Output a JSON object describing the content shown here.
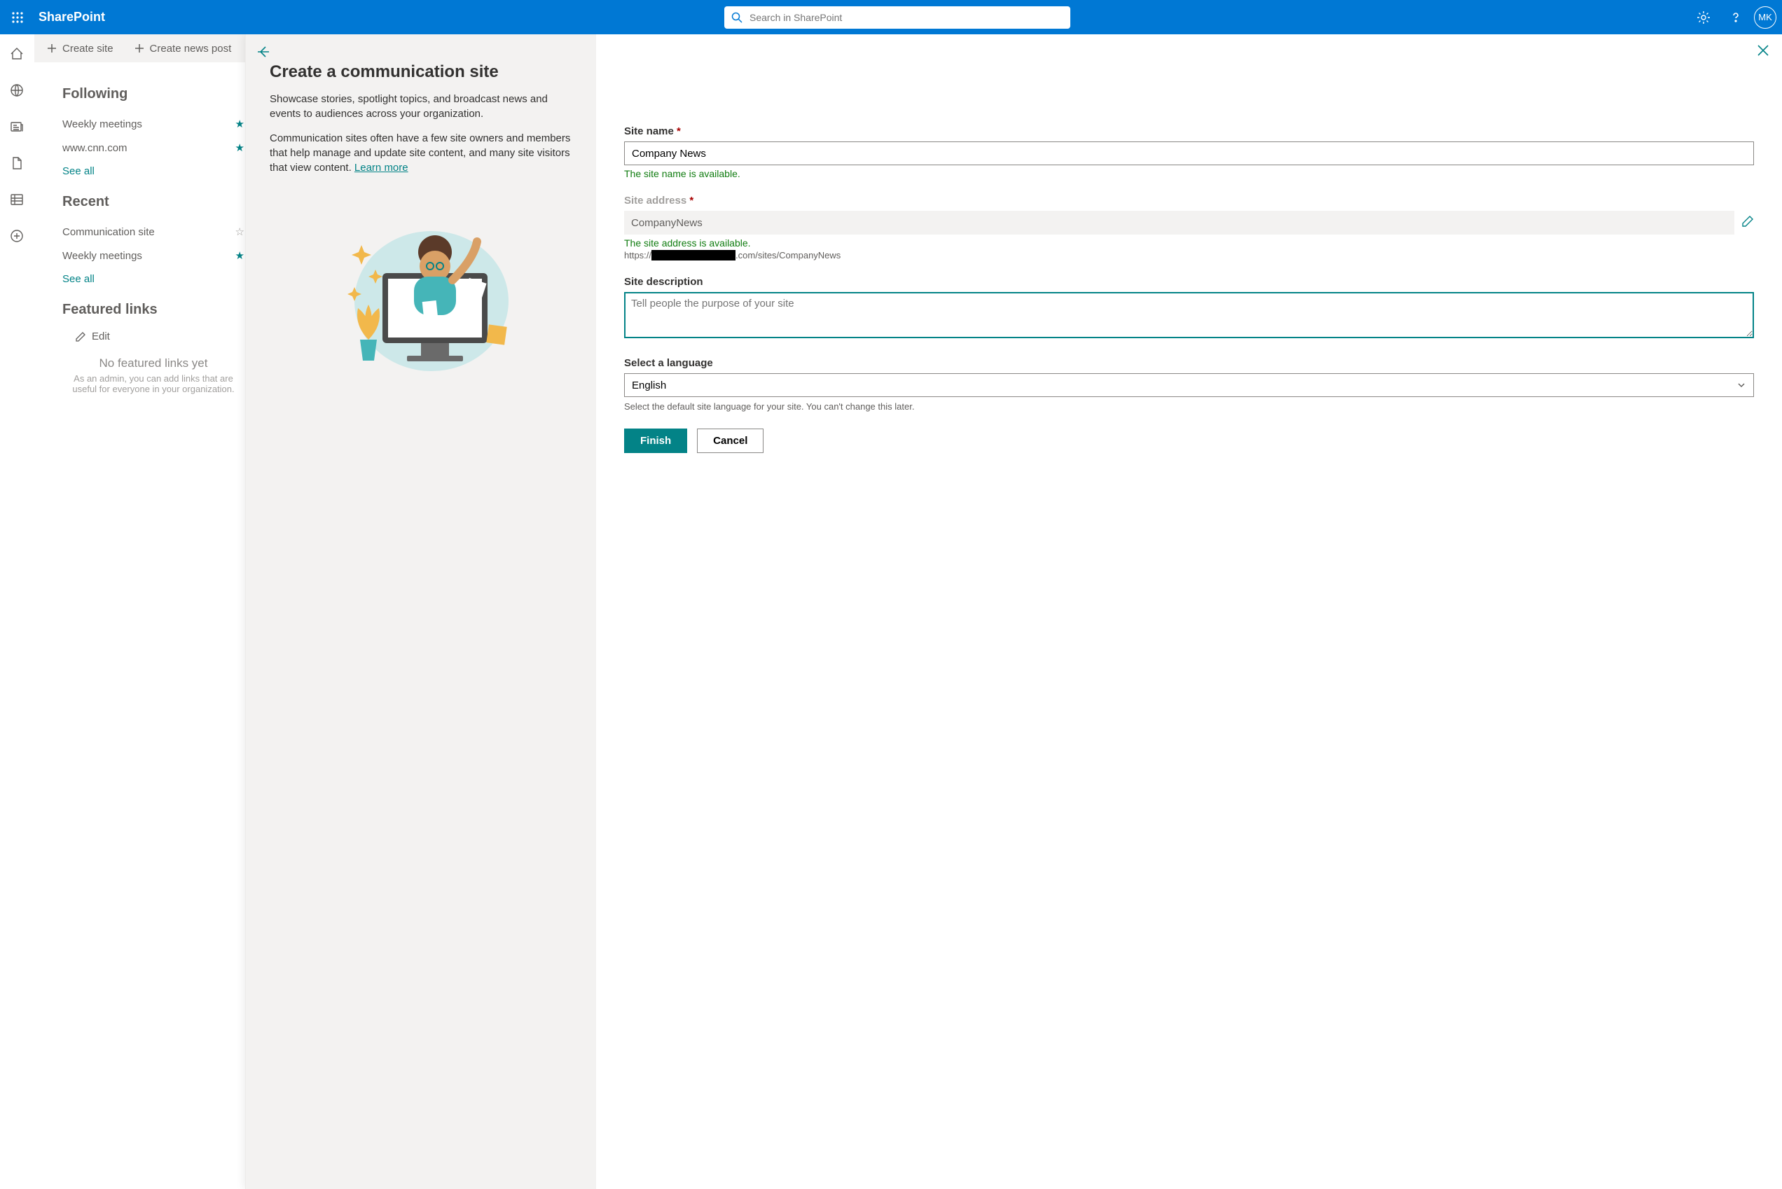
{
  "header": {
    "app_name": "SharePoint",
    "search_placeholder": "Search in SharePoint",
    "avatar_initials": "MK"
  },
  "command_bar": {
    "create_site": "Create site",
    "create_news": "Create news post"
  },
  "sidebar": {
    "following_title": "Following",
    "following_items": [
      {
        "label": "Weekly meetings",
        "starred": true
      },
      {
        "label": "www.cnn.com",
        "starred": true
      }
    ],
    "see_all": "See all",
    "recent_title": "Recent",
    "recent_items": [
      {
        "label": "Communication site",
        "starred": false
      },
      {
        "label": "Weekly meetings",
        "starred": true
      }
    ],
    "featured_title": "Featured links",
    "edit_label": "Edit",
    "featured_empty_title": "No featured links yet",
    "featured_empty_body": "As an admin, you can add links that are useful for everyone in your organization."
  },
  "dialog": {
    "title": "Create a communication site",
    "para1": "Showcase stories, spotlight topics, and broadcast news and events to audiences across your organization.",
    "para2_a": "Communication sites often have a few site owners and members that help manage and update site content, and many site visitors that view content. ",
    "learn_more": "Learn more",
    "site_name_label": "Site name",
    "site_name_value": "Company News",
    "site_name_validation": "The site name is available.",
    "site_address_label": "Site address",
    "site_address_value": "CompanyNews",
    "site_address_validation": "The site address is available.",
    "site_url_prefix": "https://",
    "site_url_suffix": ".com/sites/CompanyNews",
    "site_desc_label": "Site description",
    "site_desc_placeholder": "Tell people the purpose of your site",
    "lang_label": "Select a language",
    "lang_value": "English",
    "lang_hint": "Select the default site language for your site. You can't change this later.",
    "finish": "Finish",
    "cancel": "Cancel"
  }
}
